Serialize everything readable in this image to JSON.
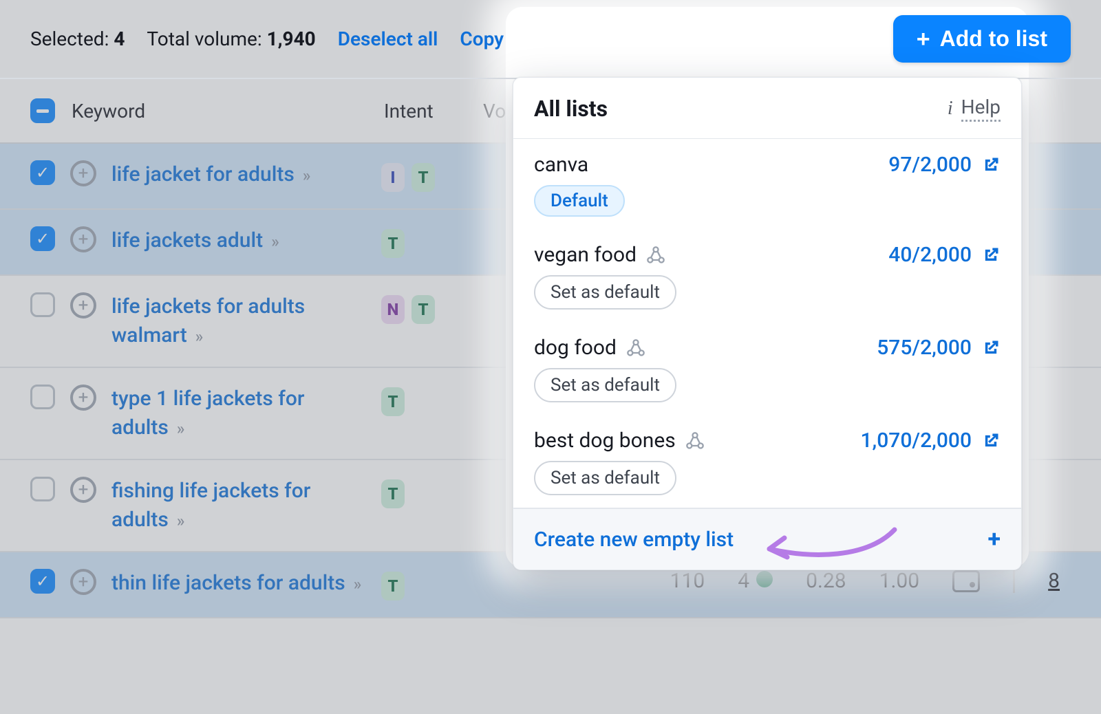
{
  "toolbar": {
    "selected_label": "Selected:",
    "selected_count": "4",
    "volume_label": "Total volume:",
    "volume_value": "1,940",
    "deselect": "Deselect all",
    "copy": "Copy",
    "add_to_list": "Add to list"
  },
  "columns": {
    "keyword": "Keyword",
    "intent": "Intent",
    "volume": "Vol"
  },
  "rows": [
    {
      "selected": true,
      "keyword": "life jacket for adults",
      "intents": [
        "I",
        "T"
      ]
    },
    {
      "selected": true,
      "keyword": "life jackets adult",
      "intents": [
        "T"
      ]
    },
    {
      "selected": false,
      "keyword": "life jackets for adults walmart",
      "intents": [
        "N",
        "T"
      ]
    },
    {
      "selected": false,
      "keyword": "type 1 life jackets for adults",
      "intents": [
        "T"
      ]
    },
    {
      "selected": false,
      "keyword": "fishing life jackets for adults",
      "intents": [
        "T"
      ]
    },
    {
      "selected": true,
      "keyword": "thin life jackets for adults",
      "intents": [
        "T"
      ],
      "metrics": {
        "volume": "110",
        "kd": "4",
        "cpc": "0.28",
        "com": "1.00",
        "results": "8"
      }
    }
  ],
  "popover": {
    "title": "All lists",
    "help": "Help",
    "lists": [
      {
        "name": "canva",
        "count": "97/2,000",
        "default": true,
        "cluster": false
      },
      {
        "name": "vegan food",
        "count": "40/2,000",
        "default": false,
        "cluster": true
      },
      {
        "name": "dog food",
        "count": "575/2,000",
        "default": false,
        "cluster": true
      },
      {
        "name": "best dog bones",
        "count": "1,070/2,000",
        "default": false,
        "cluster": true
      }
    ],
    "default_badge": "Default",
    "set_default": "Set as default",
    "create": "Create new empty list"
  }
}
